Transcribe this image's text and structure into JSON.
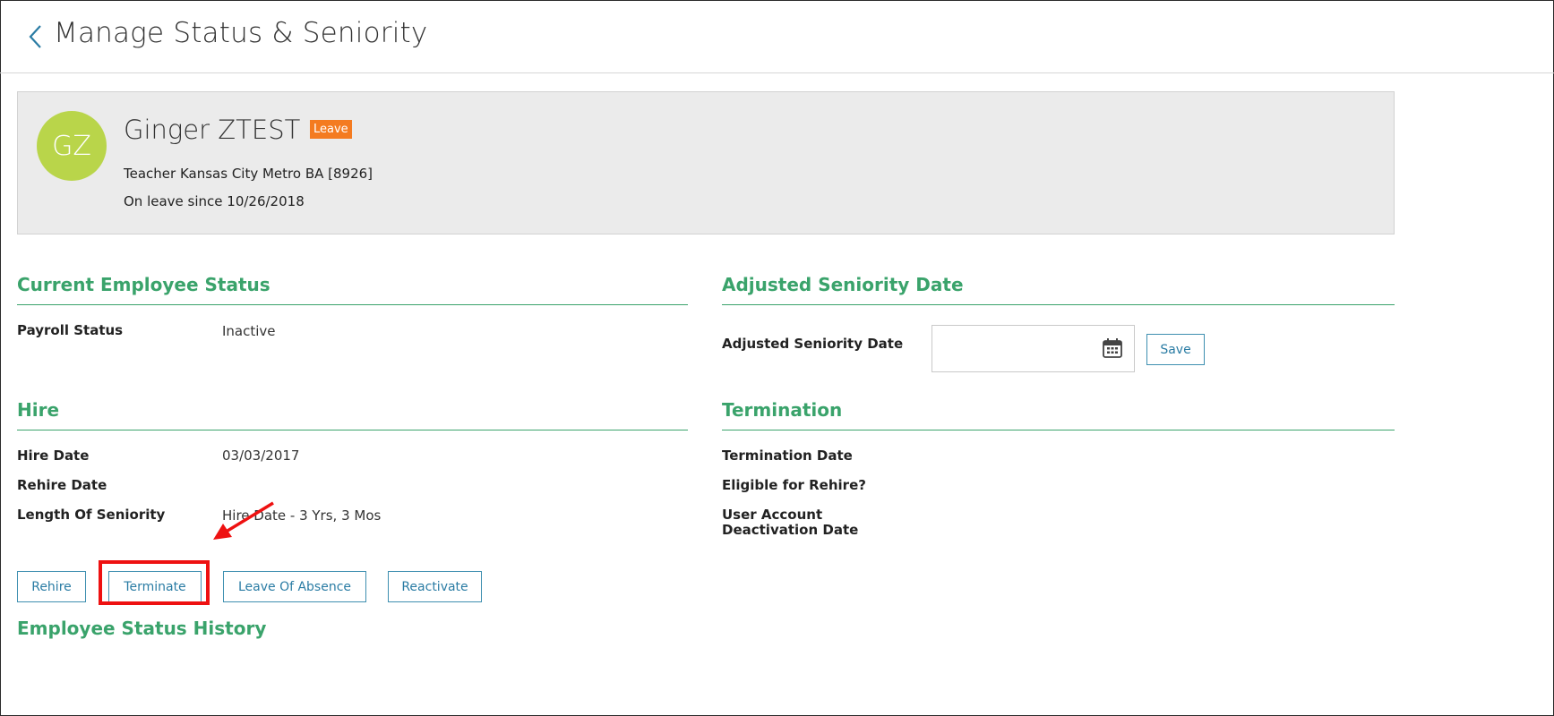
{
  "header": {
    "title": "Manage Status & Seniority",
    "back_icon": "chevron-left-icon"
  },
  "employee": {
    "initials": "GZ",
    "name": "Ginger ZTEST",
    "badge": "Leave",
    "job": "Teacher Kansas City Metro BA [8926]",
    "leave_since": "On leave since 10/26/2018",
    "avatar_color": "#b9d54a",
    "badge_color": "#f47b20"
  },
  "current_status": {
    "title": "Current Employee Status",
    "payroll_status_label": "Payroll Status",
    "payroll_status_value": "Inactive"
  },
  "adjusted_seniority": {
    "title": "Adjusted Seniority Date",
    "field_label": "Adjusted Seniority Date",
    "field_value": "",
    "calendar_icon": "calendar-icon",
    "save_label": "Save"
  },
  "hire": {
    "title": "Hire",
    "hire_date_label": "Hire Date",
    "hire_date_value": "03/03/2017",
    "rehire_date_label": "Rehire Date",
    "rehire_date_value": "",
    "length_label": "Length Of Seniority",
    "length_value": "Hire Date - 3 Yrs, 3 Mos"
  },
  "termination": {
    "title": "Termination",
    "termination_date_label": "Termination Date",
    "eligible_label": "Eligible for Rehire?",
    "deactivation_label_line1": "User Account",
    "deactivation_label_line2": "Deactivation Date"
  },
  "actions": {
    "rehire": "Rehire",
    "terminate": "Terminate",
    "leave_of_absence": "Leave Of Absence",
    "reactivate": "Reactivate"
  },
  "history": {
    "title": "Employee Status History"
  },
  "colors": {
    "section_green": "#3aa36b",
    "button_blue": "#2a7ca4",
    "annotation_red": "#ee1111"
  }
}
